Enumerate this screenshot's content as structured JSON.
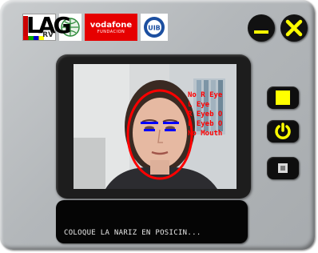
{
  "logos": {
    "lag_text": "LAG",
    "lag_sub": "RV",
    "vodafone_name": "vodafone",
    "vodafone_sub": "FUNDACION",
    "uib_text": "UIB"
  },
  "window_controls": {
    "minimize_icon": "minimize-icon",
    "close_icon": "close-icon"
  },
  "tracking_labels": [
    "No R Eye",
    "L Eye",
    "R Eyeb O",
    "L Eyeb O",
    "No Mouth"
  ],
  "status_message": "COLOQUE LA NARIZ EN POSICIN...",
  "side_buttons": [
    {
      "name": "stop-button",
      "icon": "stop-square-icon"
    },
    {
      "name": "power-button",
      "icon": "power-icon"
    },
    {
      "name": "small-window-button",
      "icon": "window-small-icon"
    }
  ],
  "colors": {
    "accent_yellow": "#ffff00",
    "tracking_red": "#ff0000",
    "tracking_blue": "#0000ff"
  }
}
